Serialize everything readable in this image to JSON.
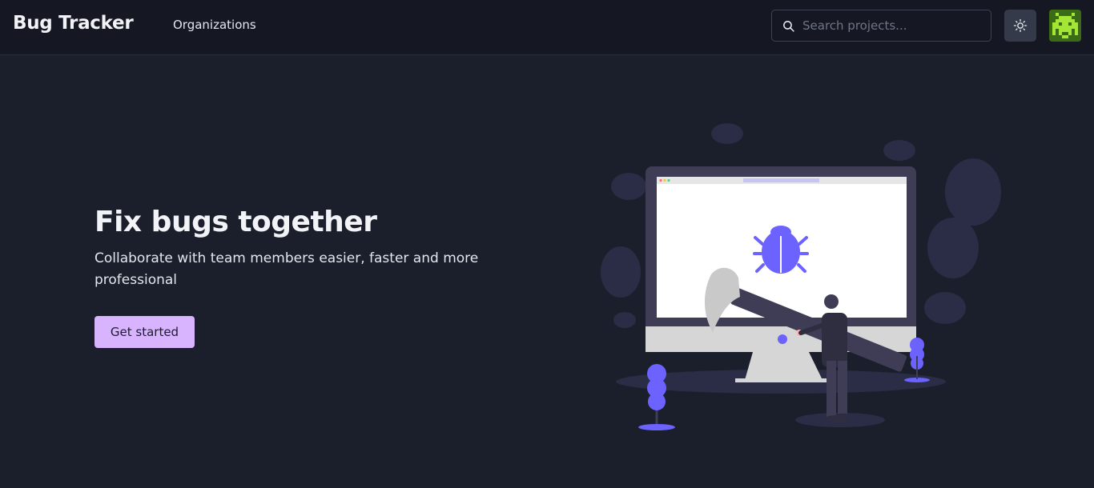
{
  "header": {
    "brand": "Bug Tracker",
    "nav": {
      "organizations": "Organizations"
    },
    "search": {
      "placeholder": "Search projects...",
      "value": ""
    }
  },
  "hero": {
    "title": "Fix bugs together",
    "subtitle": "Collaborate with team members easier, faster and more professional",
    "cta_label": "Get started"
  },
  "icons": {
    "search": "search-icon",
    "theme": "sun-icon",
    "avatar": "pixel-invader-avatar"
  },
  "colors": {
    "background": "#1b1f2b",
    "header": "#151823",
    "accent": "#d8b4fe",
    "illustration_accent": "#6c63ff",
    "avatar": "#a3e635"
  }
}
